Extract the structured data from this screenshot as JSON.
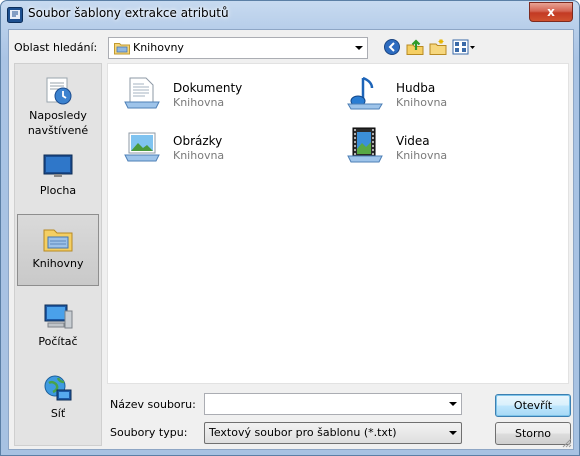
{
  "window": {
    "title": "Soubor šablony extrakce atributů",
    "close_glyph": "x"
  },
  "toolbar": {
    "look_in_label": "Oblast hledání:",
    "look_in_value": "Knihovny",
    "icons": [
      "back-icon",
      "up-folder-icon",
      "new-folder-icon",
      "views-menu-icon"
    ]
  },
  "places": [
    {
      "label": "Naposledy navštívené",
      "icon": "recent-places-icon",
      "selected": false
    },
    {
      "label": "Plocha",
      "icon": "desktop-icon",
      "selected": false
    },
    {
      "label": "Knihovny",
      "icon": "libraries-icon",
      "selected": true
    },
    {
      "label": "Počítač",
      "icon": "computer-icon",
      "selected": false
    },
    {
      "label": "Síť",
      "icon": "network-icon",
      "selected": false
    }
  ],
  "files": [
    {
      "name": "Dokumenty",
      "type": "Knihovna",
      "icon": "documents-library-icon"
    },
    {
      "name": "Hudba",
      "type": "Knihovna",
      "icon": "music-library-icon"
    },
    {
      "name": "Obrázky",
      "type": "Knihovna",
      "icon": "pictures-library-icon"
    },
    {
      "name": "Videa",
      "type": "Knihovna",
      "icon": "videos-library-icon"
    }
  ],
  "form": {
    "filename_label": "Název souboru:",
    "filename_value": "",
    "filetype_label": "Soubory typu:",
    "filetype_value": "Textový soubor pro šablonu (*.txt)"
  },
  "buttons": {
    "open": "Otevřít",
    "cancel": "Storno"
  }
}
